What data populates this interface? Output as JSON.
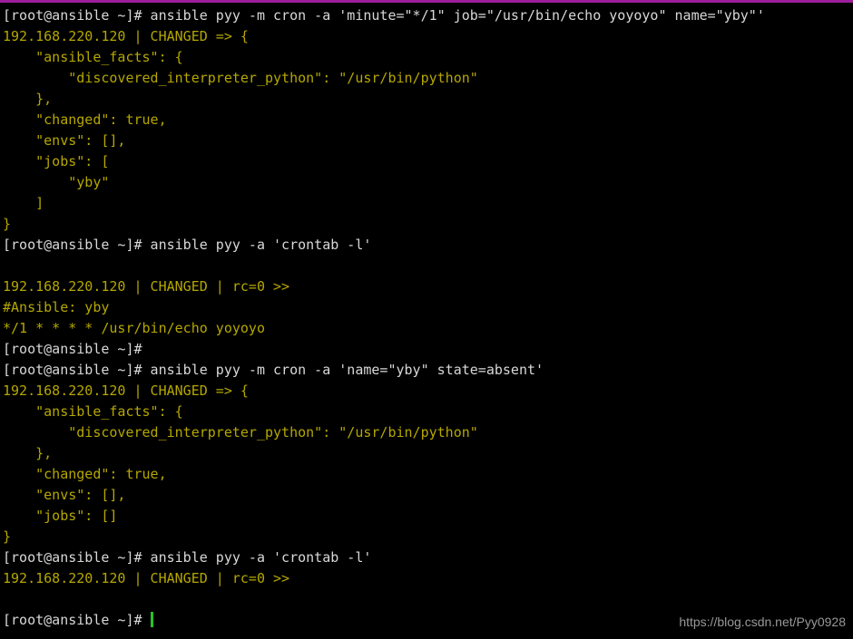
{
  "terminal": {
    "window_title": "root@ansible:~",
    "background_color": "#000000",
    "top_border_color": "#9b1f9b",
    "prompt_color": "#d8d8d8",
    "output_color": "#b5a700",
    "cursor_color": "#25c425",
    "prompt_string": "[root@ansible ~]#",
    "host": "192.168.220.120",
    "lines": [
      {
        "id": "l0",
        "kind": "prompt",
        "text": "[root@ansible ~]# ansible pyy -m cron -a 'minute=\"*/1\" job=\"/usr/bin/echo yoyoyo\" name=\"yby\"'"
      },
      {
        "id": "l1",
        "kind": "output",
        "text": "192.168.220.120 | CHANGED => {"
      },
      {
        "id": "l2",
        "kind": "output",
        "text": "    \"ansible_facts\": {"
      },
      {
        "id": "l3",
        "kind": "output",
        "text": "        \"discovered_interpreter_python\": \"/usr/bin/python\""
      },
      {
        "id": "l4",
        "kind": "output",
        "text": "    },"
      },
      {
        "id": "l5",
        "kind": "output",
        "text": "    \"changed\": true,"
      },
      {
        "id": "l6",
        "kind": "output",
        "text": "    \"envs\": [],"
      },
      {
        "id": "l7",
        "kind": "output",
        "text": "    \"jobs\": ["
      },
      {
        "id": "l8",
        "kind": "output",
        "text": "        \"yby\""
      },
      {
        "id": "l9",
        "kind": "output",
        "text": "    ]"
      },
      {
        "id": "l10",
        "kind": "output",
        "text": "}"
      },
      {
        "id": "l11",
        "kind": "prompt",
        "text": "[root@ansible ~]# ansible pyy -a 'crontab -l'"
      },
      {
        "id": "l12",
        "kind": "blank",
        "text": ""
      },
      {
        "id": "l13",
        "kind": "output",
        "text": "192.168.220.120 | CHANGED | rc=0 >>"
      },
      {
        "id": "l14",
        "kind": "output",
        "text": "#Ansible: yby"
      },
      {
        "id": "l15",
        "kind": "output",
        "text": "*/1 * * * * /usr/bin/echo yoyoyo"
      },
      {
        "id": "l16",
        "kind": "prompt",
        "text": "[root@ansible ~]#"
      },
      {
        "id": "l17",
        "kind": "prompt",
        "text": "[root@ansible ~]# ansible pyy -m cron -a 'name=\"yby\" state=absent'"
      },
      {
        "id": "l18",
        "kind": "output",
        "text": "192.168.220.120 | CHANGED => {"
      },
      {
        "id": "l19",
        "kind": "output",
        "text": "    \"ansible_facts\": {"
      },
      {
        "id": "l20",
        "kind": "output",
        "text": "        \"discovered_interpreter_python\": \"/usr/bin/python\""
      },
      {
        "id": "l21",
        "kind": "output",
        "text": "    },"
      },
      {
        "id": "l22",
        "kind": "output",
        "text": "    \"changed\": true,"
      },
      {
        "id": "l23",
        "kind": "output",
        "text": "    \"envs\": [],"
      },
      {
        "id": "l24",
        "kind": "output",
        "text": "    \"jobs\": []"
      },
      {
        "id": "l25",
        "kind": "output",
        "text": "}"
      },
      {
        "id": "l26",
        "kind": "prompt",
        "text": "[root@ansible ~]# ansible pyy -a 'crontab -l'"
      },
      {
        "id": "l27",
        "kind": "output",
        "text": "192.168.220.120 | CHANGED | rc=0 >>"
      },
      {
        "id": "l28",
        "kind": "blank",
        "text": ""
      },
      {
        "id": "l29",
        "kind": "prompt_cursor",
        "text": "[root@ansible ~]# "
      }
    ]
  },
  "watermark": {
    "text": "https://blog.csdn.net/Pyy0928"
  }
}
